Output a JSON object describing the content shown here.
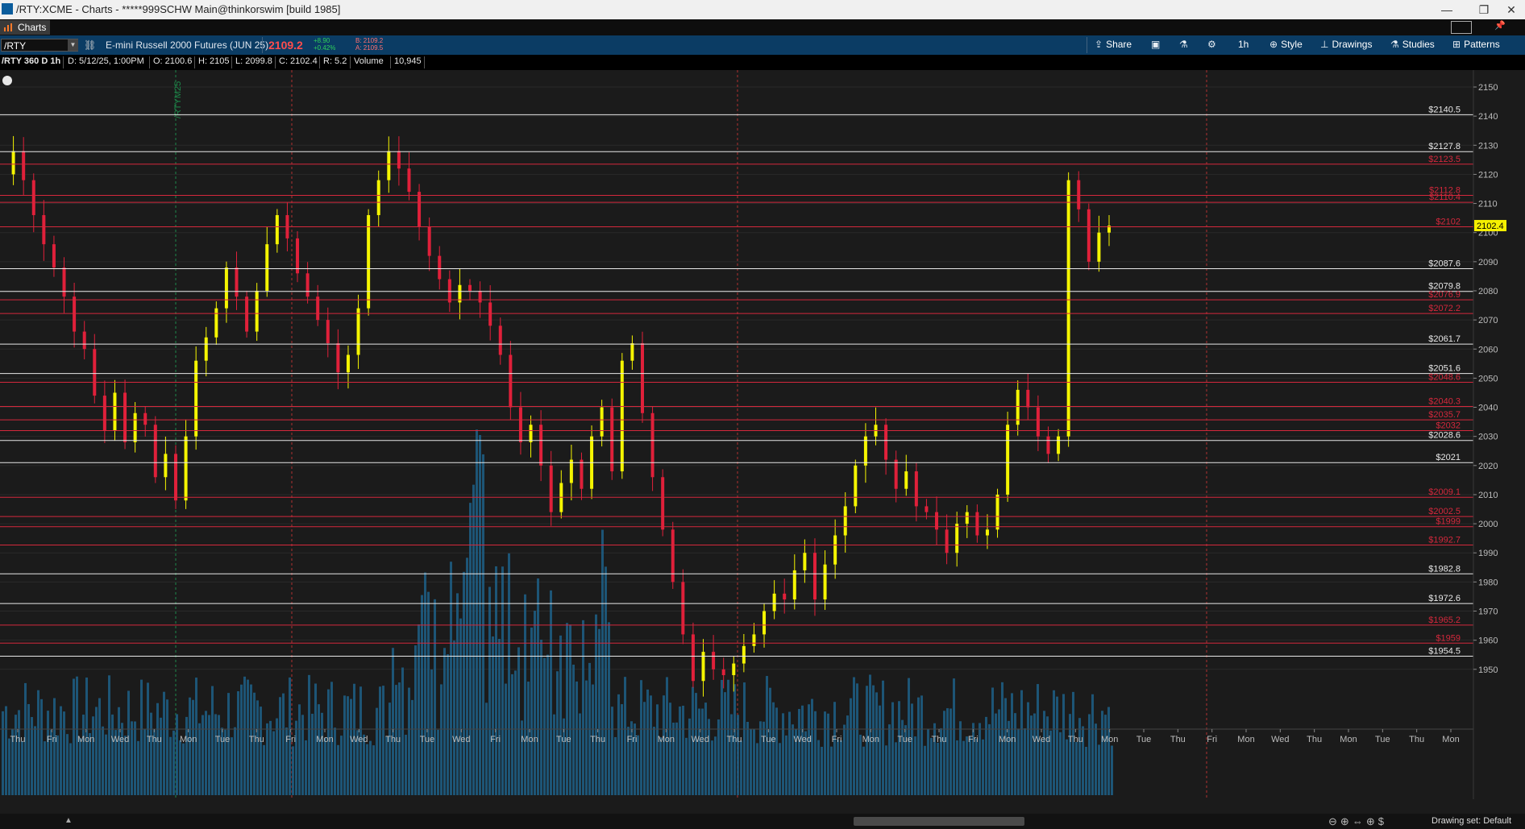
{
  "window": {
    "title": "/RTY:XCME - Charts - *****999SCHW Main@thinkorswim [build 1985]",
    "min_icon": "minimize-icon",
    "max_icon": "maximize-icon",
    "close_icon": "close-icon"
  },
  "tabs": {
    "charts_label": "Charts"
  },
  "toolbar": {
    "symbol": "/RTY",
    "contract": "E-mini Russell 2000 Futures (JUN 25)",
    "last": "2109.2",
    "net_change": "+8.90",
    "net_change_pct": "+0.42%",
    "bid": "B: 2109.2",
    "ask": "A: 2109.5",
    "share": "Share",
    "timeframe": "1h",
    "style": "Style",
    "drawings": "Drawings",
    "studies": "Studies",
    "patterns": "Patterns",
    "colors": {
      "bg": "#0b3c64",
      "last": "#ff4d4d",
      "up": "#2fd15a"
    }
  },
  "infobar": {
    "period": "/RTY 360 D 1h",
    "date": "D: 5/12/25, 1:00PM",
    "open": "O: 2100.6",
    "high": "H: 2105",
    "low": "L: 2099.8",
    "close": "C: 2102.4",
    "range": "R: 5.2",
    "volume_label": "Volume",
    "volume_value": "10,945"
  },
  "chart_data": {
    "type": "candlestick",
    "symbol": "/RTY",
    "yaxis": {
      "min": 1944,
      "max": 2156,
      "ticks": [
        1950,
        1960,
        1970,
        1980,
        1990,
        2000,
        2010,
        2020,
        2030,
        2040,
        2050,
        2060,
        2070,
        2080,
        2090,
        2100,
        2110,
        2120,
        2130,
        2140,
        2150
      ]
    },
    "xaxis": {
      "ticks": [
        "Thu",
        "Fri",
        "Mon",
        "Wed",
        "Thu",
        "Mon",
        "Tue",
        "Thu",
        "Fri",
        "Mon",
        "Wed",
        "Thu",
        "Tue",
        "Wed",
        "Fri",
        "Mon",
        "Tue",
        "Thu",
        "Fri",
        "Mon",
        "Wed",
        "Thu",
        "Tue",
        "Wed",
        "Fri",
        "Mon",
        "Tue",
        "Thu",
        "Fri",
        "Mon",
        "Wed",
        "Thu",
        "Mon",
        "Tue",
        "Thu",
        "Fri",
        "Mon",
        "Wed",
        "Thu",
        "Mon",
        "Tue",
        "Thu",
        "Mon"
      ]
    },
    "contract_marker": "/RTYM25",
    "current_price": "2102.4",
    "levels": [
      {
        "price": 2140.5,
        "label": "$2140.5",
        "color": "white"
      },
      {
        "price": 2127.8,
        "label": "$2127.8",
        "color": "white"
      },
      {
        "price": 2123.5,
        "label": "$2123.5",
        "color": "red"
      },
      {
        "price": 2112.8,
        "label": "$2112.8",
        "color": "red"
      },
      {
        "price": 2110.4,
        "label": "$2110.4",
        "color": "red"
      },
      {
        "price": 2102,
        "label": "$2102",
        "color": "red"
      },
      {
        "price": 2087.6,
        "label": "$2087.6",
        "color": "white"
      },
      {
        "price": 2079.8,
        "label": "$2079.8",
        "color": "white"
      },
      {
        "price": 2076.9,
        "label": "$2076.9",
        "color": "red"
      },
      {
        "price": 2072.2,
        "label": "$2072.2",
        "color": "red"
      },
      {
        "price": 2061.7,
        "label": "$2061.7",
        "color": "white"
      },
      {
        "price": 2051.6,
        "label": "$2051.6",
        "color": "white"
      },
      {
        "price": 2048.6,
        "label": "$2048.6",
        "color": "red"
      },
      {
        "price": 2040.3,
        "label": "$2040.3",
        "color": "red"
      },
      {
        "price": 2035.7,
        "label": "$2035.7",
        "color": "red"
      },
      {
        "price": 2032,
        "label": "$2032",
        "color": "red"
      },
      {
        "price": 2028.6,
        "label": "$2028.6",
        "color": "white"
      },
      {
        "price": 2021,
        "label": "$2021",
        "color": "white"
      },
      {
        "price": 2009.1,
        "label": "$2009.1",
        "color": "red"
      },
      {
        "price": 2002.5,
        "label": "$2002.5",
        "color": "red"
      },
      {
        "price": 1999,
        "label": "$1999",
        "color": "red"
      },
      {
        "price": 1992.7,
        "label": "$1992.7",
        "color": "red"
      },
      {
        "price": 1982.8,
        "label": "$1982.8",
        "color": "white"
      },
      {
        "price": 1972.6,
        "label": "$1972.6",
        "color": "white"
      },
      {
        "price": 1965.2,
        "label": "$1965.2",
        "color": "red"
      },
      {
        "price": 1959,
        "label": "$1959",
        "color": "red"
      },
      {
        "price": 1954.5,
        "label": "$1954.5",
        "color": "white"
      }
    ],
    "price_path": [
      2120,
      2128,
      2118,
      2106,
      2096,
      2088,
      2078,
      2066,
      2060,
      2044,
      2032,
      2045,
      2028,
      2038,
      2034,
      2016,
      2024,
      2008,
      2030,
      2056,
      2064,
      2074,
      2088,
      2078,
      2066,
      2080,
      2096,
      2106,
      2098,
      2086,
      2078,
      2070,
      2062,
      2052,
      2058,
      2074,
      2106,
      2118,
      2128,
      2122,
      2114,
      2102,
      2092,
      2084,
      2076,
      2082,
      2080,
      2076,
      2068,
      2058,
      2040,
      2028,
      2034,
      2020,
      2004,
      2014,
      2022,
      2012,
      2030,
      2040,
      2018,
      2056,
      2062,
      2038,
      2016,
      1998,
      1980,
      1962,
      1946,
      1956,
      1950,
      1948,
      1952,
      1958,
      1962,
      1970,
      1976,
      1974,
      1984,
      1990,
      1974,
      1986,
      1996,
      2006,
      2020,
      2030,
      2034,
      2022,
      2012,
      2018,
      2006,
      2004,
      1998,
      1990,
      2000,
      2004,
      1996,
      1998,
      2010,
      2034,
      2046,
      2040,
      2030,
      2024,
      2030,
      2118,
      2108,
      2090,
      2100,
      2102.4
    ],
    "volume": {
      "color": "#1d5f86"
    }
  },
  "status": {
    "drawing_set": "Drawing set: Default"
  }
}
